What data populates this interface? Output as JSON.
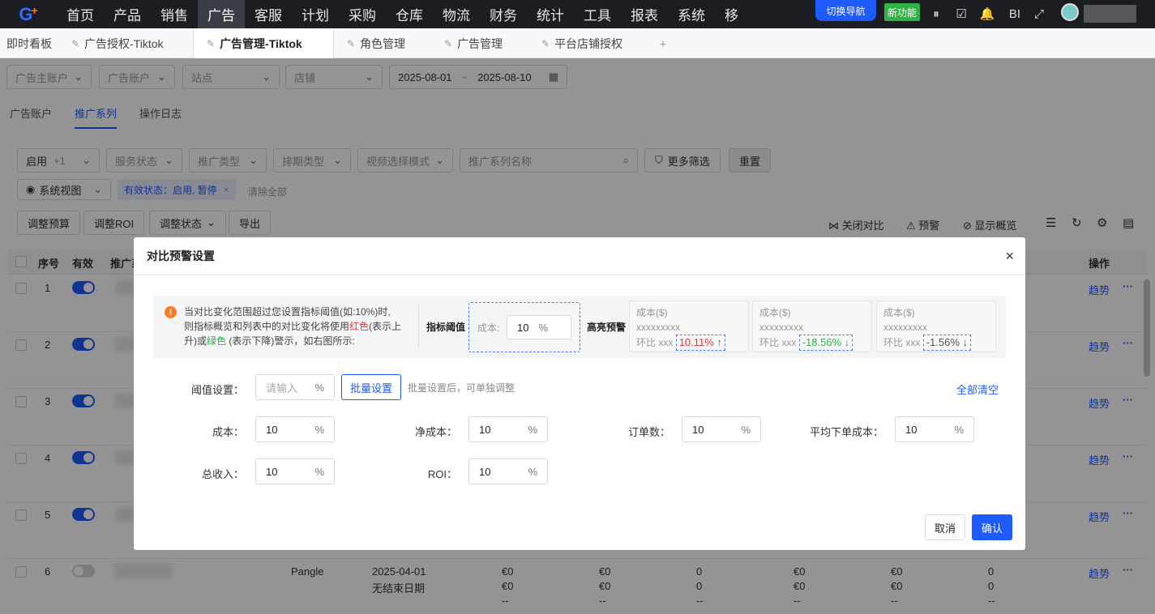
{
  "nav": {
    "items": [
      "首页",
      "产品",
      "销售",
      "广告",
      "客服",
      "计划",
      "采购",
      "仓库",
      "物流",
      "财务",
      "统计",
      "工具",
      "报表",
      "系统",
      "移"
    ],
    "active_index": 3,
    "switch_label": "切换导航",
    "new_feature_label": "新功能",
    "bi_label": "BI"
  },
  "tabs": [
    {
      "label": "即时看板"
    },
    {
      "label": "广告授权-Tiktok"
    },
    {
      "label": "广告管理-Tiktok"
    },
    {
      "label": "角色管理"
    },
    {
      "label": "广告管理"
    },
    {
      "label": "平台店铺授权"
    }
  ],
  "add_tab": "+",
  "filters": {
    "ad_account_main": "广告主账户",
    "ad_account": "广告账户",
    "site": "站点",
    "store": "店铺",
    "date_start": "2025-08-01",
    "date_sep": "~",
    "date_end": "2025-08-10"
  },
  "page_tabs": [
    "广告账户",
    "推广系列",
    "操作日志"
  ],
  "toolbar": {
    "enable_label": "启用",
    "enable_count": "+1",
    "service_status": "服务状态",
    "promo_type": "推广类型",
    "schedule_type": "排期类型",
    "video_mode": "视频选择模式",
    "search_placeholder": "推广系列名称",
    "more_filter": "更多筛选",
    "reset": "重置",
    "system_view": "系统视图",
    "active_filter": "有效状态：启用, 暂停",
    "clear_all": "清除全部",
    "adjust_budget": "调整预算",
    "adjust_roi": "调整ROI",
    "adjust_status": "调整状态",
    "export": "导出",
    "close_compare": "关闭对比",
    "alert": "预警",
    "show_overview": "显示概览"
  },
  "table": {
    "headers": {
      "seq": "序号",
      "valid": "有效",
      "campaign": "推广系",
      "action": "操作"
    },
    "rows": [
      {
        "seq": "1",
        "on": true
      },
      {
        "seq": "2",
        "on": true
      },
      {
        "seq": "3",
        "on": true
      },
      {
        "seq": "4",
        "on": true
      },
      {
        "seq": "5",
        "on": true
      },
      {
        "seq": "6",
        "on": false
      }
    ],
    "trend": "趋势",
    "more": "···",
    "row6": {
      "platform": "Pangle",
      "date": "2025-04-01",
      "end": "无结束日期",
      "v1": "€0",
      "v2": "€0",
      "v3": "0",
      "v4": "€0",
      "v5": "€0",
      "v6": "0",
      "dash": "--"
    },
    "partial_pct": "%"
  },
  "modal": {
    "title": "对比预警设置",
    "close": "×",
    "notice_line1": "当对比变化范围超过您设置指标阈值(如:10%)时,",
    "notice_line2_a": "则指标概览和列表中的对比变化将使用",
    "notice_red": "红色",
    "notice_line2_b": "(表示上",
    "notice_line3_a": "升)或",
    "notice_green": "绿色",
    "notice_line3_b": " (表示下降)警示，如右图所示:",
    "threshold_label": "指标阈值",
    "example_field": "成本:",
    "example_value": "10",
    "pct": "%",
    "highlight_label": "高亮预警",
    "cards": [
      {
        "title": "成本($)",
        "value": "xxxxxxxxx",
        "ratio": "环比 xxx",
        "change": "10.11% ↑",
        "dir": "up"
      },
      {
        "title": "成本($)",
        "value": "xxxxxxxxx",
        "ratio": "环比 xxx",
        "change": "-18.56% ↓",
        "dir": "down"
      },
      {
        "title": "成本($)",
        "value": "xxxxxxxxx",
        "ratio": "环比 xxx",
        "change": "-1.56% ↓",
        "dir": "neutral"
      }
    ],
    "threshold_setting_label": "阈值设置：",
    "threshold_placeholder": "请输入",
    "batch_btn": "批量设置",
    "batch_hint": "批量设置后，可单独调整",
    "clear_all": "全部清空",
    "fields": [
      {
        "label": "成本：",
        "value": "10"
      },
      {
        "label": "净成本：",
        "value": "10"
      },
      {
        "label": "订单数：",
        "value": "10"
      },
      {
        "label": "平均下单成本：",
        "value": "10"
      },
      {
        "label": "总收入：",
        "value": "10"
      },
      {
        "label": "ROI：",
        "value": "10"
      }
    ],
    "cancel": "取消",
    "confirm": "确认"
  },
  "colors": {
    "accent": "#1e5bff",
    "up": "#e23b3b",
    "down": "#2fb344",
    "warn": "#ff7a1a"
  }
}
